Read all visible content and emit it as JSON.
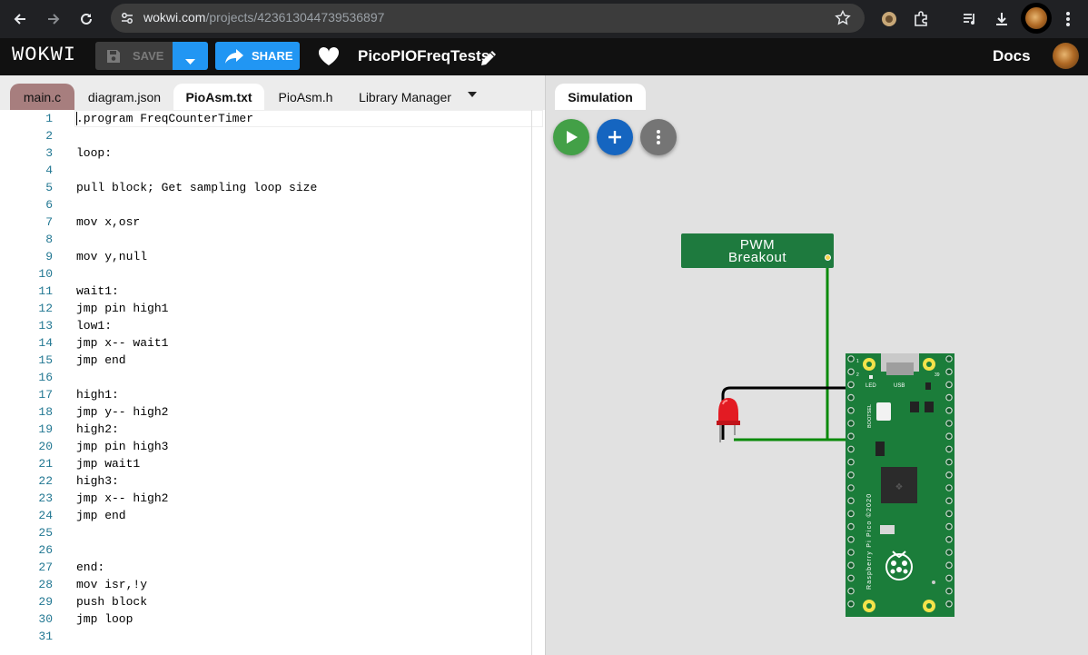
{
  "browser": {
    "url_host": "wokwi.com",
    "url_path": "/projects/423613044739536897",
    "icons": [
      "back-arrow-icon",
      "forward-arrow-icon",
      "reload-icon",
      "site-info-icon",
      "bookmark-star-icon",
      "extension-icon",
      "puzzle-icon",
      "media-queue-icon",
      "download-icon",
      "profile-avatar",
      "kebab-menu-icon"
    ]
  },
  "app": {
    "logo": "WOKWI",
    "save_label": "SAVE",
    "share_label": "SHARE",
    "project_name": "PicoPIOFreqTests",
    "docs_label": "Docs"
  },
  "editor": {
    "tabs": [
      {
        "label": "main.c"
      },
      {
        "label": "diagram.json"
      },
      {
        "label": "PioAsm.txt"
      },
      {
        "label": "PioAsm.h"
      },
      {
        "label": "Library Manager"
      }
    ],
    "active_tab": "PioAsm.txt",
    "lines": [
      ".program FreqCounterTimer",
      "",
      "loop:",
      "",
      "pull block; Get sampling loop size",
      "",
      "mov x,osr",
      "",
      "mov y,null",
      "",
      "wait1:",
      "jmp pin high1",
      "low1:",
      "jmp x-- wait1",
      "jmp end",
      "",
      "high1:",
      "jmp y-- high2",
      "high2:",
      "jmp pin high3",
      "jmp wait1",
      "high3:",
      "jmp x-- high2",
      "jmp end",
      "",
      "",
      "end:",
      "mov isr,!y",
      "push block",
      "jmp loop",
      ""
    ]
  },
  "simulation": {
    "tab_label": "Simulation",
    "pwm_title_line1": "PWM",
    "pwm_title_line2": "Breakout",
    "board": {
      "pin_labels": [
        "1",
        "2",
        "39"
      ],
      "led_label": "LED",
      "usb_label": "USB",
      "bootsel_label": "BOOTSEL",
      "silkscreen": "Raspberry Pi Pico ©2020"
    },
    "colors": {
      "board_green": "#1b7d3a",
      "wire_green": "#0b8a0b",
      "wire_black": "#000000",
      "led_red": "#e31b23"
    }
  }
}
